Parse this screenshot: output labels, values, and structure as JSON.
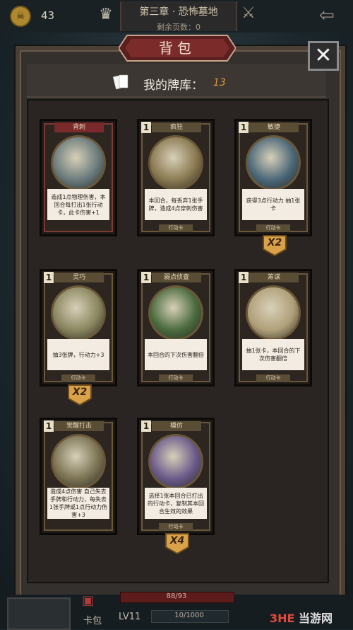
{
  "topbar": {
    "coin_icon": "skull-coin-icon",
    "coin_count": "43",
    "chapter_title": "第三章 · 恐怖墓地",
    "pages_left": "剩余页数：0"
  },
  "panel": {
    "title": "背包",
    "close_glyph": "✕",
    "deck_label": "我的牌库：",
    "deck_count": "13"
  },
  "cards": [
    {
      "name": "背刺",
      "cost": "",
      "desc": "造成1点物理伤害，本回合每打出1张行动卡，此卡伤害+1",
      "type": "",
      "multiplier": "",
      "style": "red",
      "art": "#6a7a7c"
    },
    {
      "name": "疯狂",
      "cost": "1",
      "desc": "本回合，每丢弃1张手牌，造成4点穿刺伤害",
      "type": "行动卡",
      "multiplier": "",
      "style": "",
      "art": "#8a7a52"
    },
    {
      "name": "敏捷",
      "cost": "1",
      "desc": "获得3点行动力 抽1张卡",
      "type": "行动卡",
      "multiplier": "X2",
      "style": "",
      "art": "#4a6678"
    },
    {
      "name": "灵巧",
      "cost": "1",
      "desc": "抽3张牌，行动力+3",
      "type": "行动卡",
      "multiplier": "X2",
      "style": "",
      "art": "#8a8660"
    },
    {
      "name": "弱点侦查",
      "cost": "1",
      "desc": "本回合的下次伤害翻倍",
      "type": "行动卡",
      "multiplier": "",
      "style": "",
      "art": "#4a6a3e"
    },
    {
      "name": "筹谋",
      "cost": "1",
      "desc": "抽1张卡，本回合的下次伤害翻倍",
      "type": "行动卡",
      "multiplier": "",
      "style": "",
      "art": "#b0a07a"
    },
    {
      "name": "觉醒打击",
      "cost": "1",
      "desc": "造成4点伤害 自己失去手牌和行动力，每失去1张手牌或1点行动力伤害+3",
      "type": "",
      "multiplier": "",
      "style": "",
      "art": "#7a7252"
    },
    {
      "name": "模仿",
      "cost": "1",
      "desc": "选择1张本回合已打出的行动卡，复制其本回合生效的效果",
      "type": "行动卡",
      "multiplier": "X4",
      "style": "",
      "art": "#6a5a8a"
    }
  ],
  "bottom": {
    "hp": "88/93",
    "bag_label": "卡包",
    "level": "LV11",
    "xp": "10/1000",
    "logo_prefix": "3HE",
    "logo_suffix": "当游网"
  }
}
